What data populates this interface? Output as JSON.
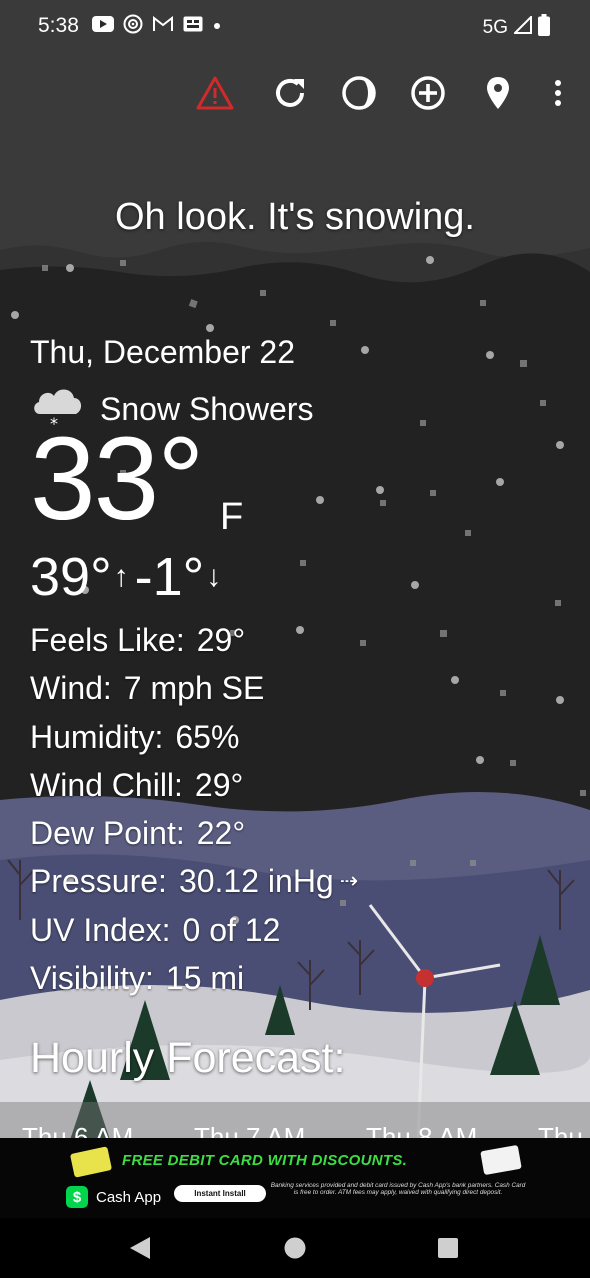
{
  "status_bar": {
    "time": "5:38",
    "network": "5G",
    "icons": [
      "youtube-icon",
      "target-icon",
      "gmail-icon",
      "sim-card-icon",
      "notification-dot-icon"
    ]
  },
  "toolbar": {
    "icons": [
      "alert-triangle-icon",
      "refresh-icon",
      "moon-phase-icon",
      "add-location-icon",
      "map-pin-icon",
      "more-vert-icon"
    ],
    "alert_color": "#d12a2a"
  },
  "weather": {
    "headline": "Oh look. It's snowing.",
    "date": "Thu, December 22",
    "condition": "Snow Showers",
    "condition_icon": "snow-cloud-icon",
    "temperature": "33°",
    "unit": "F",
    "high": "39°",
    "high_arrow": "↑",
    "low": "-1°",
    "low_arrow": "↓"
  },
  "details": [
    {
      "label": "Feels Like:",
      "value": "29°"
    },
    {
      "label": "Wind:",
      "value": "7 mph SE"
    },
    {
      "label": "Humidity:",
      "value": "65%"
    },
    {
      "label": "Wind Chill:",
      "value": "29°"
    },
    {
      "label": "Dew Point:",
      "value": "22°"
    },
    {
      "label": "Pressure:",
      "value": "30.12 inHg",
      "trend": "⇢"
    },
    {
      "label": "UV Index:",
      "value": "0 of 12"
    },
    {
      "label": "Visibility:",
      "value": "15 mi"
    }
  ],
  "hourly": {
    "title": "Hourly Forecast:",
    "items": [
      "Thu 6 AM",
      "Thu 7 AM",
      "Thu 8 AM",
      "Thu"
    ]
  },
  "ad": {
    "headline": "FREE DEBIT CARD WITH DISCOUNTS.",
    "brand": "Cash App",
    "brand_logo": "$",
    "button": "Instant Install",
    "fine_print": "Banking services provided and debit card issued by Cash App's bank partners. Cash Card is free to order. ATM fees may apply, waived with qualifying direct deposit.",
    "accent_color": "#3cde43"
  },
  "nav": {
    "icons": [
      "back-icon",
      "home-icon",
      "recents-icon"
    ]
  }
}
